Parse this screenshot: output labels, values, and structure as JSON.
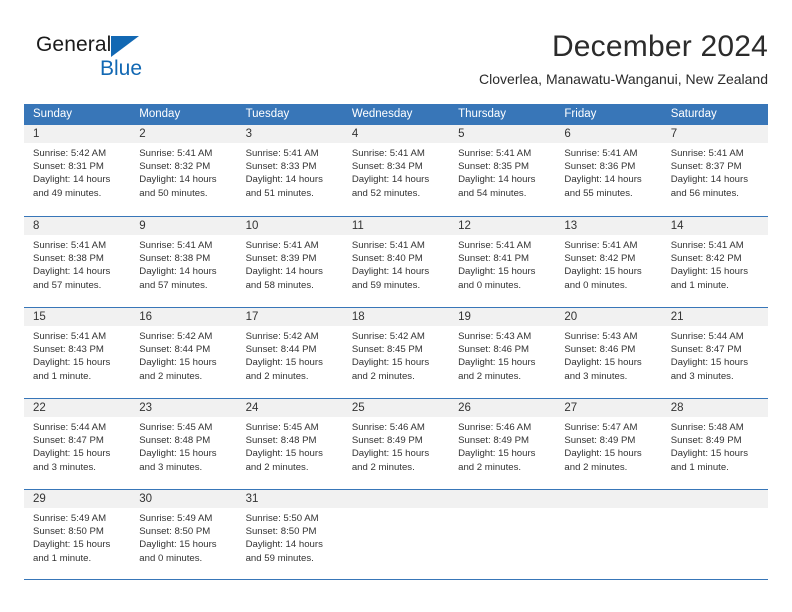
{
  "brand": {
    "name_part1": "General",
    "name_part2": "Blue",
    "logo_icon": "triangle-logo-icon"
  },
  "header": {
    "month_title": "December 2024",
    "location": "Cloverlea, Manawatu-Wanganui, New Zealand",
    "accent_color": "#3876b8",
    "brand_color": "#1268b3"
  },
  "calendar": {
    "weekdays": [
      "Sunday",
      "Monday",
      "Tuesday",
      "Wednesday",
      "Thursday",
      "Friday",
      "Saturday"
    ],
    "weeks": [
      [
        {
          "day": "1",
          "sunrise": "Sunrise: 5:42 AM",
          "sunset": "Sunset: 8:31 PM",
          "daylight_line1": "Daylight: 14 hours",
          "daylight_line2": "and 49 minutes."
        },
        {
          "day": "2",
          "sunrise": "Sunrise: 5:41 AM",
          "sunset": "Sunset: 8:32 PM",
          "daylight_line1": "Daylight: 14 hours",
          "daylight_line2": "and 50 minutes."
        },
        {
          "day": "3",
          "sunrise": "Sunrise: 5:41 AM",
          "sunset": "Sunset: 8:33 PM",
          "daylight_line1": "Daylight: 14 hours",
          "daylight_line2": "and 51 minutes."
        },
        {
          "day": "4",
          "sunrise": "Sunrise: 5:41 AM",
          "sunset": "Sunset: 8:34 PM",
          "daylight_line1": "Daylight: 14 hours",
          "daylight_line2": "and 52 minutes."
        },
        {
          "day": "5",
          "sunrise": "Sunrise: 5:41 AM",
          "sunset": "Sunset: 8:35 PM",
          "daylight_line1": "Daylight: 14 hours",
          "daylight_line2": "and 54 minutes."
        },
        {
          "day": "6",
          "sunrise": "Sunrise: 5:41 AM",
          "sunset": "Sunset: 8:36 PM",
          "daylight_line1": "Daylight: 14 hours",
          "daylight_line2": "and 55 minutes."
        },
        {
          "day": "7",
          "sunrise": "Sunrise: 5:41 AM",
          "sunset": "Sunset: 8:37 PM",
          "daylight_line1": "Daylight: 14 hours",
          "daylight_line2": "and 56 minutes."
        }
      ],
      [
        {
          "day": "8",
          "sunrise": "Sunrise: 5:41 AM",
          "sunset": "Sunset: 8:38 PM",
          "daylight_line1": "Daylight: 14 hours",
          "daylight_line2": "and 57 minutes."
        },
        {
          "day": "9",
          "sunrise": "Sunrise: 5:41 AM",
          "sunset": "Sunset: 8:38 PM",
          "daylight_line1": "Daylight: 14 hours",
          "daylight_line2": "and 57 minutes."
        },
        {
          "day": "10",
          "sunrise": "Sunrise: 5:41 AM",
          "sunset": "Sunset: 8:39 PM",
          "daylight_line1": "Daylight: 14 hours",
          "daylight_line2": "and 58 minutes."
        },
        {
          "day": "11",
          "sunrise": "Sunrise: 5:41 AM",
          "sunset": "Sunset: 8:40 PM",
          "daylight_line1": "Daylight: 14 hours",
          "daylight_line2": "and 59 minutes."
        },
        {
          "day": "12",
          "sunrise": "Sunrise: 5:41 AM",
          "sunset": "Sunset: 8:41 PM",
          "daylight_line1": "Daylight: 15 hours",
          "daylight_line2": "and 0 minutes."
        },
        {
          "day": "13",
          "sunrise": "Sunrise: 5:41 AM",
          "sunset": "Sunset: 8:42 PM",
          "daylight_line1": "Daylight: 15 hours",
          "daylight_line2": "and 0 minutes."
        },
        {
          "day": "14",
          "sunrise": "Sunrise: 5:41 AM",
          "sunset": "Sunset: 8:42 PM",
          "daylight_line1": "Daylight: 15 hours",
          "daylight_line2": "and 1 minute."
        }
      ],
      [
        {
          "day": "15",
          "sunrise": "Sunrise: 5:41 AM",
          "sunset": "Sunset: 8:43 PM",
          "daylight_line1": "Daylight: 15 hours",
          "daylight_line2": "and 1 minute."
        },
        {
          "day": "16",
          "sunrise": "Sunrise: 5:42 AM",
          "sunset": "Sunset: 8:44 PM",
          "daylight_line1": "Daylight: 15 hours",
          "daylight_line2": "and 2 minutes."
        },
        {
          "day": "17",
          "sunrise": "Sunrise: 5:42 AM",
          "sunset": "Sunset: 8:44 PM",
          "daylight_line1": "Daylight: 15 hours",
          "daylight_line2": "and 2 minutes."
        },
        {
          "day": "18",
          "sunrise": "Sunrise: 5:42 AM",
          "sunset": "Sunset: 8:45 PM",
          "daylight_line1": "Daylight: 15 hours",
          "daylight_line2": "and 2 minutes."
        },
        {
          "day": "19",
          "sunrise": "Sunrise: 5:43 AM",
          "sunset": "Sunset: 8:46 PM",
          "daylight_line1": "Daylight: 15 hours",
          "daylight_line2": "and 2 minutes."
        },
        {
          "day": "20",
          "sunrise": "Sunrise: 5:43 AM",
          "sunset": "Sunset: 8:46 PM",
          "daylight_line1": "Daylight: 15 hours",
          "daylight_line2": "and 3 minutes."
        },
        {
          "day": "21",
          "sunrise": "Sunrise: 5:44 AM",
          "sunset": "Sunset: 8:47 PM",
          "daylight_line1": "Daylight: 15 hours",
          "daylight_line2": "and 3 minutes."
        }
      ],
      [
        {
          "day": "22",
          "sunrise": "Sunrise: 5:44 AM",
          "sunset": "Sunset: 8:47 PM",
          "daylight_line1": "Daylight: 15 hours",
          "daylight_line2": "and 3 minutes."
        },
        {
          "day": "23",
          "sunrise": "Sunrise: 5:45 AM",
          "sunset": "Sunset: 8:48 PM",
          "daylight_line1": "Daylight: 15 hours",
          "daylight_line2": "and 3 minutes."
        },
        {
          "day": "24",
          "sunrise": "Sunrise: 5:45 AM",
          "sunset": "Sunset: 8:48 PM",
          "daylight_line1": "Daylight: 15 hours",
          "daylight_line2": "and 2 minutes."
        },
        {
          "day": "25",
          "sunrise": "Sunrise: 5:46 AM",
          "sunset": "Sunset: 8:49 PM",
          "daylight_line1": "Daylight: 15 hours",
          "daylight_line2": "and 2 minutes."
        },
        {
          "day": "26",
          "sunrise": "Sunrise: 5:46 AM",
          "sunset": "Sunset: 8:49 PM",
          "daylight_line1": "Daylight: 15 hours",
          "daylight_line2": "and 2 minutes."
        },
        {
          "day": "27",
          "sunrise": "Sunrise: 5:47 AM",
          "sunset": "Sunset: 8:49 PM",
          "daylight_line1": "Daylight: 15 hours",
          "daylight_line2": "and 2 minutes."
        },
        {
          "day": "28",
          "sunrise": "Sunrise: 5:48 AM",
          "sunset": "Sunset: 8:49 PM",
          "daylight_line1": "Daylight: 15 hours",
          "daylight_line2": "and 1 minute."
        }
      ],
      [
        {
          "day": "29",
          "sunrise": "Sunrise: 5:49 AM",
          "sunset": "Sunset: 8:50 PM",
          "daylight_line1": "Daylight: 15 hours",
          "daylight_line2": "and 1 minute."
        },
        {
          "day": "30",
          "sunrise": "Sunrise: 5:49 AM",
          "sunset": "Sunset: 8:50 PM",
          "daylight_line1": "Daylight: 15 hours",
          "daylight_line2": "and 0 minutes."
        },
        {
          "day": "31",
          "sunrise": "Sunrise: 5:50 AM",
          "sunset": "Sunset: 8:50 PM",
          "daylight_line1": "Daylight: 14 hours",
          "daylight_line2": "and 59 minutes."
        },
        {
          "day": "",
          "sunrise": "",
          "sunset": "",
          "daylight_line1": "",
          "daylight_line2": ""
        },
        {
          "day": "",
          "sunrise": "",
          "sunset": "",
          "daylight_line1": "",
          "daylight_line2": ""
        },
        {
          "day": "",
          "sunrise": "",
          "sunset": "",
          "daylight_line1": "",
          "daylight_line2": ""
        },
        {
          "day": "",
          "sunrise": "",
          "sunset": "",
          "daylight_line1": "",
          "daylight_line2": ""
        }
      ]
    ]
  }
}
